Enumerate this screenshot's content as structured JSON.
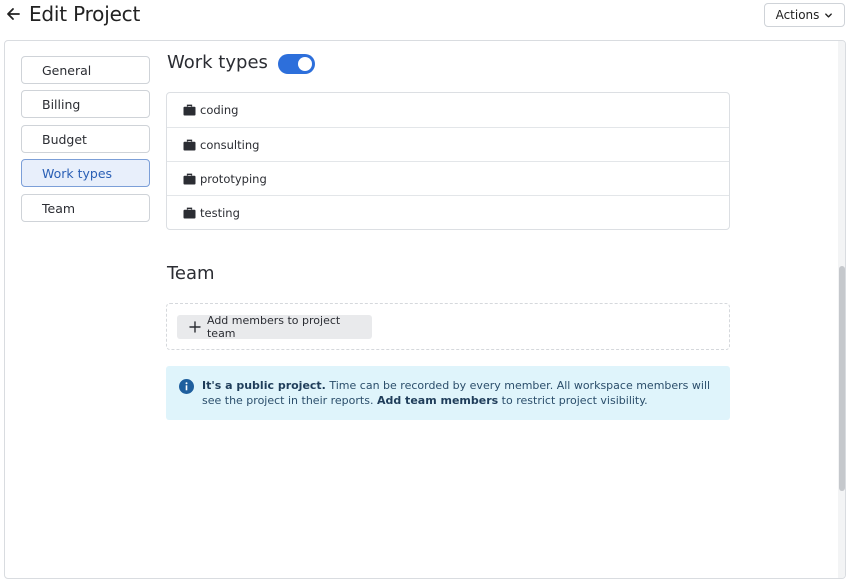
{
  "header": {
    "title": "Edit Project",
    "actions_label": "Actions"
  },
  "nav": {
    "items": [
      {
        "label": "General"
      },
      {
        "label": "Billing"
      },
      {
        "label": "Budget"
      },
      {
        "label": "Work types",
        "active": true
      },
      {
        "label": "Team"
      }
    ]
  },
  "work_types": {
    "title": "Work types",
    "enabled": true,
    "items": [
      "coding",
      "consulting",
      "prototyping",
      "testing"
    ]
  },
  "team": {
    "title": "Team",
    "add_members_label": "Add members to project team",
    "info": {
      "strong1": "It's a public project.",
      "text1": " Time can be recorded by every member. All workspace members will see the project in their reports. ",
      "strong2": "Add team members",
      "text2": " to restrict project visibility."
    }
  },
  "colors": {
    "accent": "#2d6fdb",
    "info_bg": "#dff4fb",
    "active_nav_bg": "#e8effb"
  }
}
